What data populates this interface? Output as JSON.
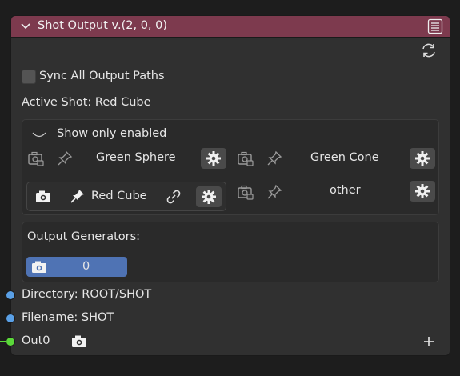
{
  "node": {
    "title": "Shot Output v.(2, 0, 0)",
    "header_color": "#7d3a4e",
    "sync_label": "Sync All Output Paths",
    "active_shot_label": "Active Shot: Red Cube"
  },
  "shots_panel": {
    "show_only_enabled": "Show only enabled",
    "shots": [
      {
        "name": "Green Sphere",
        "active": false
      },
      {
        "name": "Green Cone",
        "active": false
      },
      {
        "name": "Red Cube",
        "active": true
      },
      {
        "name": "other",
        "active": false
      }
    ]
  },
  "generators": {
    "label": "Output Generators:",
    "value": "0",
    "field_color": "#4f73b4"
  },
  "outputs": {
    "directory": "Directory: ROOT/SHOT",
    "filename": "Filename: SHOT",
    "out0": "Out0",
    "socket_blue": "#5aa0e6",
    "socket_green": "#5bd83a"
  },
  "icons": [
    "chevron-down-icon",
    "menu-icon",
    "refresh-icon",
    "camera-icon",
    "pin-icon",
    "gear-icon",
    "link-icon",
    "plus-icon"
  ]
}
